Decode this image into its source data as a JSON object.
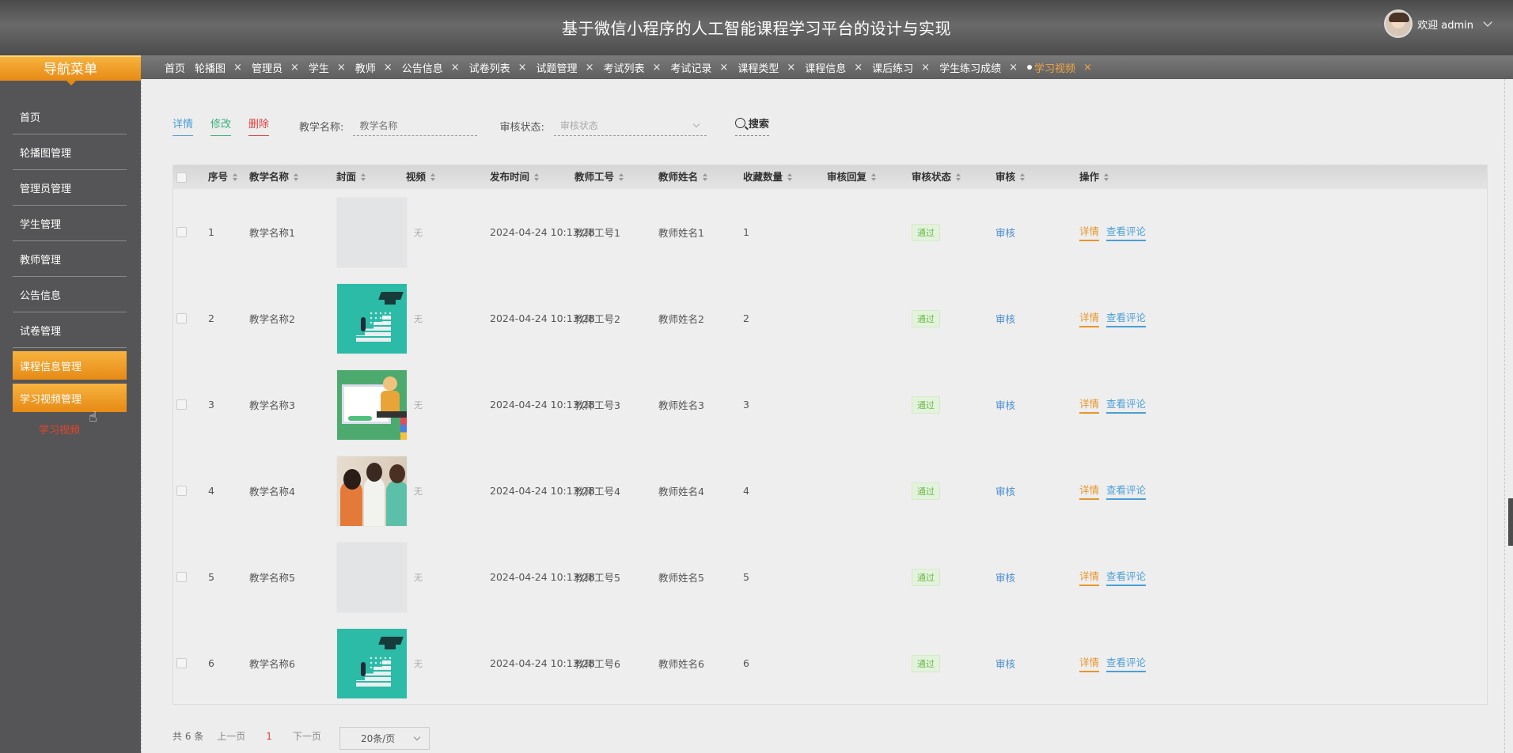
{
  "header": {
    "title": "基于微信小程序的人工智能课程学习平台的设计与实现",
    "welcome": "欢迎 admin"
  },
  "tabs": [
    {
      "label": "首页",
      "closable": false
    },
    {
      "label": "轮播图",
      "closable": true
    },
    {
      "label": "管理员",
      "closable": true
    },
    {
      "label": "学生",
      "closable": true
    },
    {
      "label": "教师",
      "closable": true
    },
    {
      "label": "公告信息",
      "closable": true
    },
    {
      "label": "试卷列表",
      "closable": true
    },
    {
      "label": "试题管理",
      "closable": true
    },
    {
      "label": "考试列表",
      "closable": true
    },
    {
      "label": "考试记录",
      "closable": true
    },
    {
      "label": "课程类型",
      "closable": true
    },
    {
      "label": "课程信息",
      "closable": true
    },
    {
      "label": "课后练习",
      "closable": true
    },
    {
      "label": "学生练习成绩",
      "closable": true
    },
    {
      "label": "学习视频",
      "closable": true,
      "active": true
    }
  ],
  "sidebar": {
    "title": "导航菜单",
    "items": [
      {
        "label": "首页"
      },
      {
        "label": "轮播图管理"
      },
      {
        "label": "管理员管理"
      },
      {
        "label": "学生管理"
      },
      {
        "label": "教师管理"
      },
      {
        "label": "公告信息"
      },
      {
        "label": "试卷管理"
      },
      {
        "label": "课程信息管理",
        "highlight": true
      },
      {
        "label": "学习视频管理",
        "highlight": true
      }
    ],
    "sub_item": "学习视频"
  },
  "toolbar": {
    "detail": "详情",
    "edit": "修改",
    "delete": "删除",
    "name_label": "教学名称:",
    "name_placeholder": "教学名称",
    "status_label": "审核状态:",
    "status_placeholder": "审核状态",
    "search": "搜索"
  },
  "table": {
    "columns": [
      "序号",
      "教学名称",
      "封面",
      "视频",
      "发布时间",
      "教师工号",
      "教师姓名",
      "收藏数量",
      "审核回复",
      "审核状态",
      "审核",
      "操作"
    ],
    "rows": [
      {
        "no": "1",
        "name": "教学名称1",
        "cover": "blank",
        "video": "无",
        "time": "2024-04-24 10:13:28",
        "tid": "教师工号1",
        "tname": "教师姓名1",
        "fav": "1",
        "reply": "",
        "status": "通过",
        "audit": "审核",
        "op_detail": "详情",
        "op_comment": "查看评论"
      },
      {
        "no": "2",
        "name": "教学名称2",
        "cover": "teal",
        "video": "无",
        "time": "2024-04-24 10:13:28",
        "tid": "教师工号2",
        "tname": "教师姓名2",
        "fav": "2",
        "reply": "",
        "status": "通过",
        "audit": "审核",
        "op_detail": "详情",
        "op_comment": "查看评论"
      },
      {
        "no": "3",
        "name": "教学名称3",
        "cover": "board",
        "video": "无",
        "time": "2024-04-24 10:13:28",
        "tid": "教师工号3",
        "tname": "教师姓名3",
        "fav": "3",
        "reply": "",
        "status": "通过",
        "audit": "审核",
        "op_detail": "详情",
        "op_comment": "查看评论"
      },
      {
        "no": "4",
        "name": "教学名称4",
        "cover": "photo",
        "video": "无",
        "time": "2024-04-24 10:13:28",
        "tid": "教师工号4",
        "tname": "教师姓名4",
        "fav": "4",
        "reply": "",
        "status": "通过",
        "audit": "审核",
        "op_detail": "详情",
        "op_comment": "查看评论"
      },
      {
        "no": "5",
        "name": "教学名称5",
        "cover": "blank",
        "video": "无",
        "time": "2024-04-24 10:13:28",
        "tid": "教师工号5",
        "tname": "教师姓名5",
        "fav": "5",
        "reply": "",
        "status": "通过",
        "audit": "审核",
        "op_detail": "详情",
        "op_comment": "查看评论"
      },
      {
        "no": "6",
        "name": "教学名称6",
        "cover": "teal",
        "video": "无",
        "time": "2024-04-24 10:13:28",
        "tid": "教师工号6",
        "tname": "教师姓名6",
        "fav": "6",
        "reply": "",
        "status": "通过",
        "audit": "审核",
        "op_detail": "详情",
        "op_comment": "查看评论"
      }
    ]
  },
  "pager": {
    "total": "共 6 条",
    "prev": "上一页",
    "current": "1",
    "next": "下一页",
    "size": "20条/页"
  },
  "colors": {
    "accent": "#e68a15",
    "danger": "#e0403a",
    "link": "#4a9fd8",
    "success": "#3ab07a"
  }
}
